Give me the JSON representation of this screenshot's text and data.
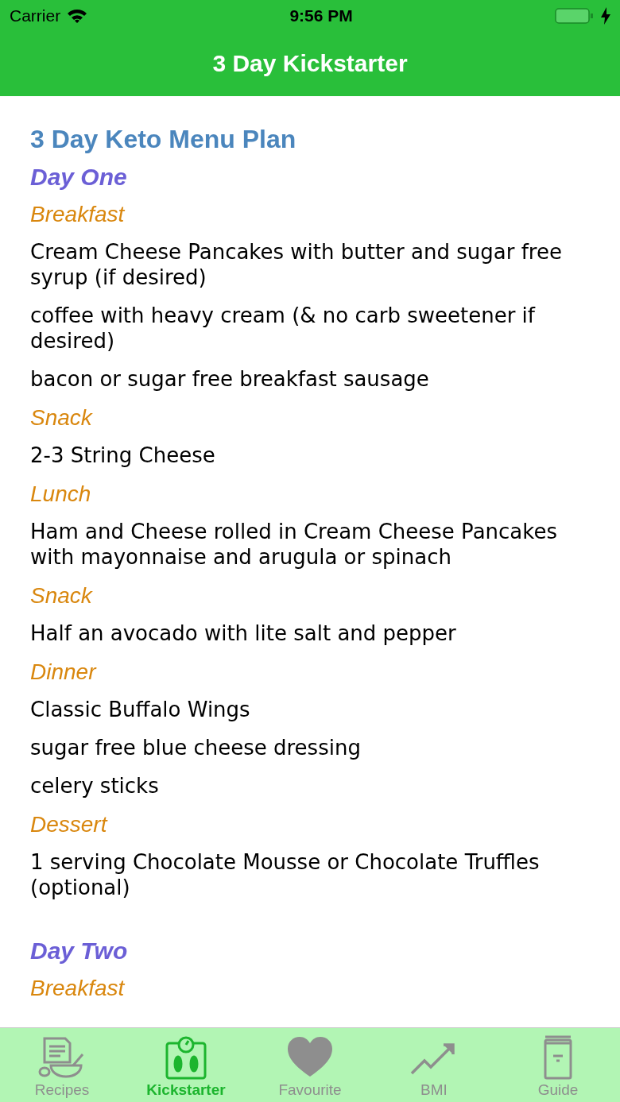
{
  "status_bar": {
    "carrier": "Carrier",
    "time": "9:56 PM",
    "charging": true
  },
  "nav_bar": {
    "title": "3 Day Kickstarter"
  },
  "content": [
    {
      "kind": "heading",
      "text": "3 Day Keto Menu Plan"
    },
    {
      "kind": "day",
      "text": "Day One"
    },
    {
      "kind": "meal",
      "text": "Breakfast"
    },
    {
      "kind": "item",
      "text": "Cream Cheese Pancakes with butter and sugar free syrup (if desired)"
    },
    {
      "kind": "item",
      "text": "coffee with heavy cream (& no carb sweetener if desired)"
    },
    {
      "kind": "item",
      "text": "bacon or sugar free breakfast sausage"
    },
    {
      "kind": "meal",
      "text": "Snack"
    },
    {
      "kind": "item",
      "text": "2-3 String Cheese"
    },
    {
      "kind": "meal",
      "text": "Lunch"
    },
    {
      "kind": "item",
      "text": "Ham and Cheese rolled in Cream Cheese Pancakes with mayonnaise and arugula or spinach"
    },
    {
      "kind": "meal",
      "text": "Snack"
    },
    {
      "kind": "item",
      "text": "Half an avocado with lite salt and pepper"
    },
    {
      "kind": "meal",
      "text": "Dinner"
    },
    {
      "kind": "item",
      "text": "Classic Buffalo Wings"
    },
    {
      "kind": "item",
      "text": "sugar free blue cheese dressing"
    },
    {
      "kind": "item",
      "text": "celery sticks"
    },
    {
      "kind": "meal",
      "text": "Dessert"
    },
    {
      "kind": "item",
      "text": "1 serving Chocolate Mousse or Chocolate Truffles (optional)"
    },
    {
      "kind": "day",
      "text": "Day Two"
    },
    {
      "kind": "meal",
      "text": "Breakfast"
    }
  ],
  "tab_bar": [
    {
      "label": "Recipes",
      "kind": "recipes",
      "selected": false
    },
    {
      "label": "Kickstarter",
      "kind": "scale",
      "selected": true
    },
    {
      "label": "Favourite",
      "kind": "heart",
      "selected": false
    },
    {
      "label": "BMI",
      "kind": "trend",
      "selected": false
    },
    {
      "label": "Guide",
      "kind": "book",
      "selected": false
    }
  ]
}
